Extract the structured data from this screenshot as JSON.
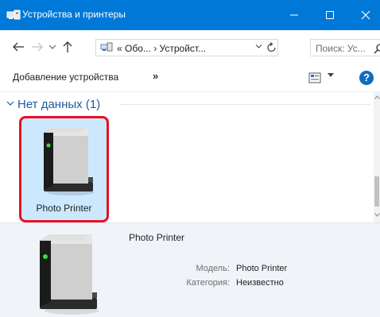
{
  "window": {
    "title": "Устройства и принтеры",
    "accent_color": "#0078d7"
  },
  "address": {
    "breadcrumb": "« Обо... › Устройст...",
    "search_placeholder": "Поиск: Ус..."
  },
  "toolbar": {
    "add_device_label": "Добавление устройства",
    "more_label": "»",
    "help_label": "?"
  },
  "group": {
    "title": "Нет данных (1)",
    "expanded": true
  },
  "devices": [
    {
      "name": "Photo Printer",
      "icon": "generic-device-icon",
      "selected": true
    }
  ],
  "details": {
    "name": "Photo Printer",
    "model_label": "Модель:",
    "model_value": "Photo Printer",
    "category_label": "Категория:",
    "category_value": "Неизвестно"
  },
  "highlight_color": "#e81123"
}
